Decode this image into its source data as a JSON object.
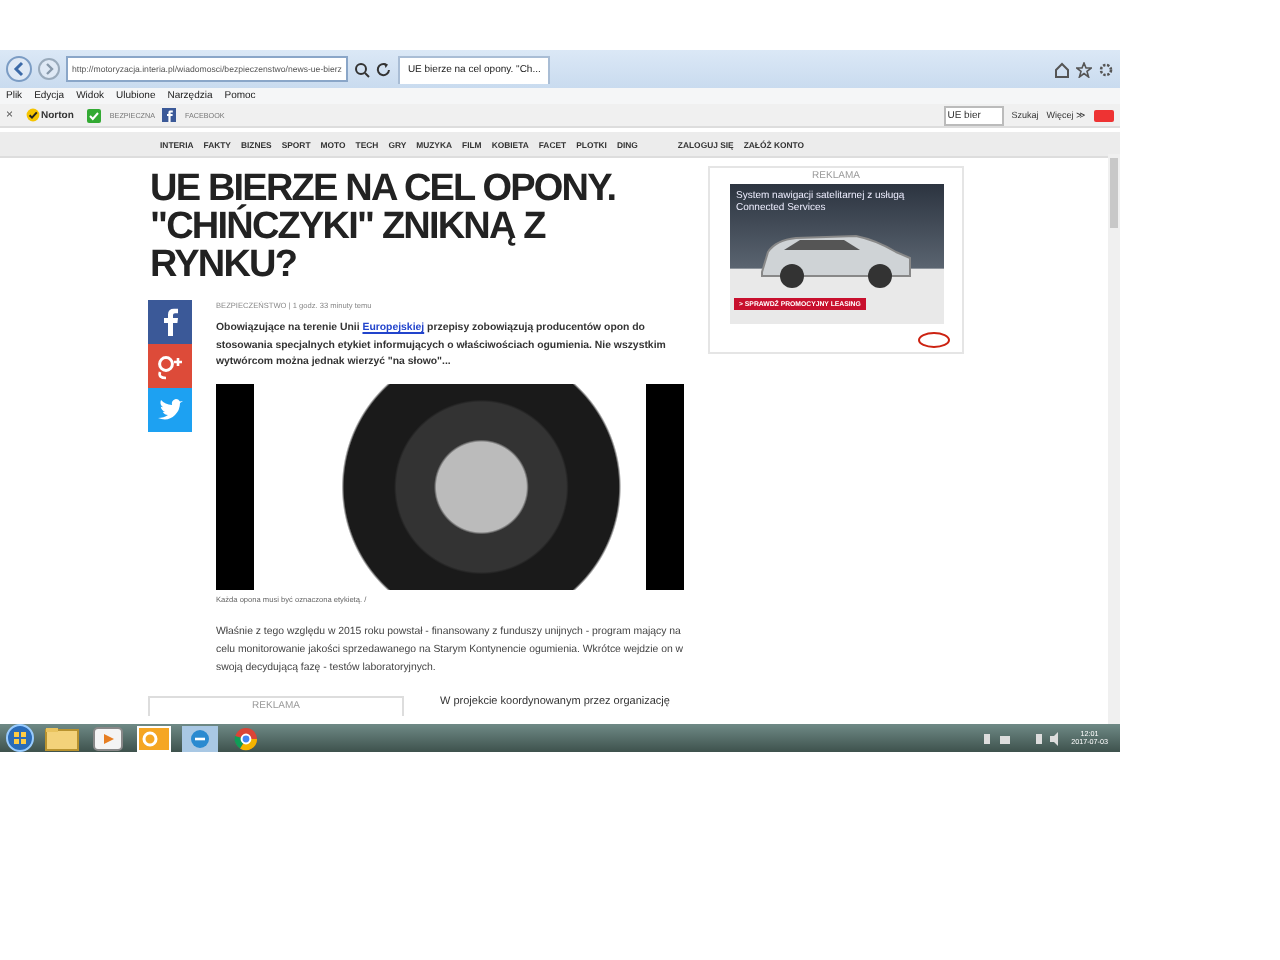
{
  "browser": {
    "address": "http://motoryzacja.interia.pl/wiadomosci/bezpieczenstwo/news-ue-bierz",
    "tabs": [
      {
        "label": "UE bierze na cel opony. \"Ch...",
        "selected": true
      }
    ],
    "menu": [
      "Plik",
      "Edycja",
      "Widok",
      "Ulubione",
      "Narzędzia",
      "Pomoc"
    ],
    "toolbar": {
      "close": "×",
      "norton": "Norton",
      "safe": "BEZPIECZNA",
      "facebook": "FACEBOOK",
      "search_value": "UE bier",
      "search_button": "Szukaj",
      "more": "Więcej ≫"
    }
  },
  "site_nav": {
    "items": [
      {
        "label": "INTERIA"
      },
      {
        "label": "FAKTY"
      },
      {
        "label": "BIZNES"
      },
      {
        "label": "SPORT"
      },
      {
        "label": "MOTO"
      },
      {
        "label": "TECH"
      },
      {
        "label": "GRY"
      },
      {
        "label": "MUZYKA"
      },
      {
        "label": "FILM"
      },
      {
        "label": "KOBIETA"
      },
      {
        "label": "FACET"
      },
      {
        "label": "PLOTKI"
      },
      {
        "label": "DING"
      }
    ],
    "login": "ZALOGUJ SIĘ",
    "register": "ZAŁÓŻ KONTO"
  },
  "article": {
    "title": "UE BIERZE NA CEL OPONY. \"CHIŃCZYKI\" ZNIKNĄ Z RYNKU?",
    "meta": "BEZPIECZEŃSTWO | 1 godz. 33 minuty temu",
    "lead": {
      "before": "Obowiązujące na terenie Unii",
      "link": "Europejskiej",
      "after": "przepisy zobowiązują producentów opon do stosowania specjalnych etykiet informujących o właściwościach ogumienia. Nie wszystkim wytwórcom można jednak wierzyć \"na słowo\"..."
    },
    "caption": "Każda opona musi być oznaczona etykietą. /",
    "body": "Właśnie z tego względu w 2015 roku powstał - finansowany z funduszy unijnych - program mający na celu monitorowanie jakości sprzedawanego na Starym Kontynencie ogumienia. Wkrótce wejdzie on w swoją decydującą fazę - testów laboratoryjnych.",
    "next": "W projekcie koordynowanym przez organizację",
    "inline_ad_label": "REKLAMA"
  },
  "ad": {
    "label": "REKLAMA",
    "headline": "System nawigacji satelitarnej z usługą Connected Services",
    "cta": "> SPRAWDŹ PROMOCYJNY LEASING"
  },
  "taskbar": {
    "time": "12:01",
    "date": "2017-07-03"
  }
}
